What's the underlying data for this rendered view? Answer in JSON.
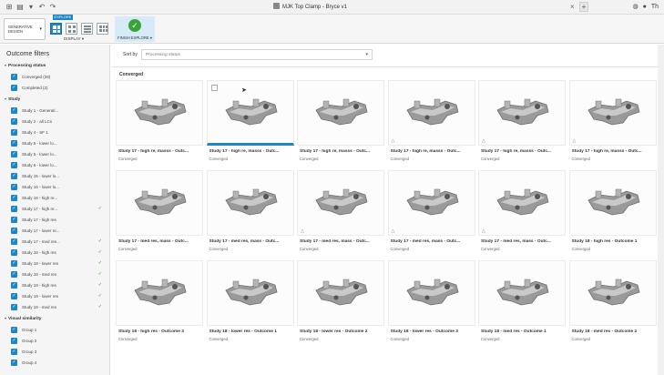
{
  "window": {
    "doc_title": "MJK Top Clamp - Bryce v1",
    "tab_close": "×",
    "tab_add": "+",
    "right_text": "Th"
  },
  "toolbar": {
    "workspace_line1": "GENERATIVE",
    "workspace_line2": "DESIGN",
    "explore_tab": "EXPLORE",
    "display_label": "DISPLAY ▾",
    "finish_label": "FINISH EXPLORE ▾"
  },
  "sidebar": {
    "title": "Outcome filters",
    "processing_status": {
      "label": "Processing status",
      "items": [
        "Converged (28)",
        "Completed (2)"
      ]
    },
    "study": {
      "label": "Study",
      "items": [
        {
          "label": "Study 1 - Generati...",
          "check": false
        },
        {
          "label": "Study 2 - all LCs",
          "check": false
        },
        {
          "label": "Study 4 - SF 1",
          "check": false
        },
        {
          "label": "Study 5 - lower lo...",
          "check": false
        },
        {
          "label": "Study 5 - lower lo...",
          "check": false
        },
        {
          "label": "Study 6 - lower lo...",
          "check": false
        },
        {
          "label": "Study 15 - lower lo...",
          "check": false
        },
        {
          "label": "Study 15 - lower lo...",
          "check": false
        },
        {
          "label": "Study 16 - high re...",
          "check": false
        },
        {
          "label": "Study 17 - high re...",
          "check": true
        },
        {
          "label": "Study 17 - high res",
          "check": false
        },
        {
          "label": "Study 17 - lower re...",
          "check": false
        },
        {
          "label": "Study 17 - med res...",
          "check": true
        },
        {
          "label": "Study 18 - high res",
          "check": true
        },
        {
          "label": "Study 18 - lower res",
          "check": true
        },
        {
          "label": "Study 18 - med res",
          "check": true
        },
        {
          "label": "Study 19 - high res",
          "check": true
        },
        {
          "label": "Study 19 - lower res",
          "check": true
        },
        {
          "label": "Study 19 - med res",
          "check": true
        }
      ]
    },
    "visual_similarity": {
      "label": "Visual similarity",
      "items": [
        "Group 1",
        "Group 2",
        "Group 3",
        "Group 4"
      ]
    }
  },
  "main": {
    "sort_label": "Sort by",
    "sort_placeholder": "Processing status",
    "group_label": "Converged",
    "cards": [
      {
        "title": "Study 17 - high re, masss - Outc...",
        "status": "Converged",
        "warn": false,
        "selected": false
      },
      {
        "title": "Study 17 - high re, masss - Outc...",
        "status": "Converged",
        "warn": false,
        "selected": true
      },
      {
        "title": "Study 17 - high re, masss - Outc...",
        "status": "Converged",
        "warn": false,
        "selected": false
      },
      {
        "title": "Study 17 - high re, masss - Outc...",
        "status": "Converged",
        "warn": true,
        "selected": false
      },
      {
        "title": "Study 17 - high re, masss - Outc...",
        "status": "Converged",
        "warn": true,
        "selected": false
      },
      {
        "title": "Study 17 - high re, masss - Outc...",
        "status": "Converged",
        "warn": true,
        "selected": false
      },
      {
        "title": "Study 17 - med res, mass - Outc...",
        "status": "Converged",
        "warn": false,
        "selected": false
      },
      {
        "title": "Study 17 - med res, mass - Outc...",
        "status": "Converged",
        "warn": false,
        "selected": false
      },
      {
        "title": "Study 17 - med res, mass - Outc...",
        "status": "Converged",
        "warn": true,
        "selected": false
      },
      {
        "title": "Study 17 - med res, mass - Outc...",
        "status": "Converged",
        "warn": true,
        "selected": false
      },
      {
        "title": "Study 17 - med res, mass - Outc...",
        "status": "Converged",
        "warn": true,
        "selected": false
      },
      {
        "title": "Study 18 - high res - Outcome 1",
        "status": "Converged",
        "warn": false,
        "selected": false
      },
      {
        "title": "Study 18 - high res - Outcome 3",
        "status": "Converged",
        "warn": false,
        "selected": false
      },
      {
        "title": "Study 18 - lower res - Outcome 1",
        "status": "Converged",
        "warn": false,
        "selected": false
      },
      {
        "title": "Study 18 - lower res - Outcome 2",
        "status": "Converged",
        "warn": false,
        "selected": false
      },
      {
        "title": "Study 18 - lower res - Outcome 3",
        "status": "Converged",
        "warn": false,
        "selected": false
      },
      {
        "title": "Study 18 - med res - Outcome 1",
        "status": "Converged",
        "warn": false,
        "selected": false
      },
      {
        "title": "Study 18 - med res - Outcome 2",
        "status": "Converged",
        "warn": false,
        "selected": false
      }
    ]
  },
  "colors": {
    "accent": "#1b86c8",
    "check": "#2aa02a",
    "finish_bg": "#d6ebf7"
  }
}
